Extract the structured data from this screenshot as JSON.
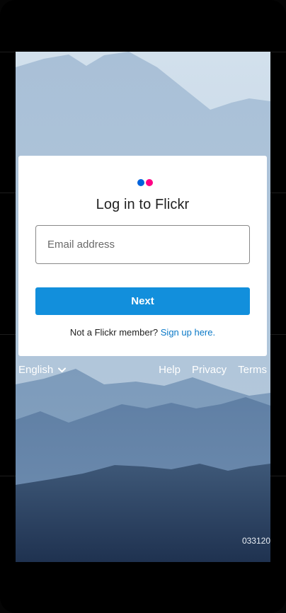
{
  "login": {
    "title": "Log in to Flickr",
    "email_placeholder": "Email address",
    "next_label": "Next",
    "signup_prompt": "Not a Flickr member?",
    "signup_link": "Sign up here."
  },
  "footer": {
    "language": "English",
    "links": [
      "Help",
      "Privacy",
      "Terms"
    ]
  },
  "photo": {
    "id_text": "033120"
  },
  "brand": {
    "logo_blue": "#0063dc",
    "logo_pink": "#ff0084",
    "button_color": "#128fdc",
    "link_color": "#0b79c7"
  }
}
